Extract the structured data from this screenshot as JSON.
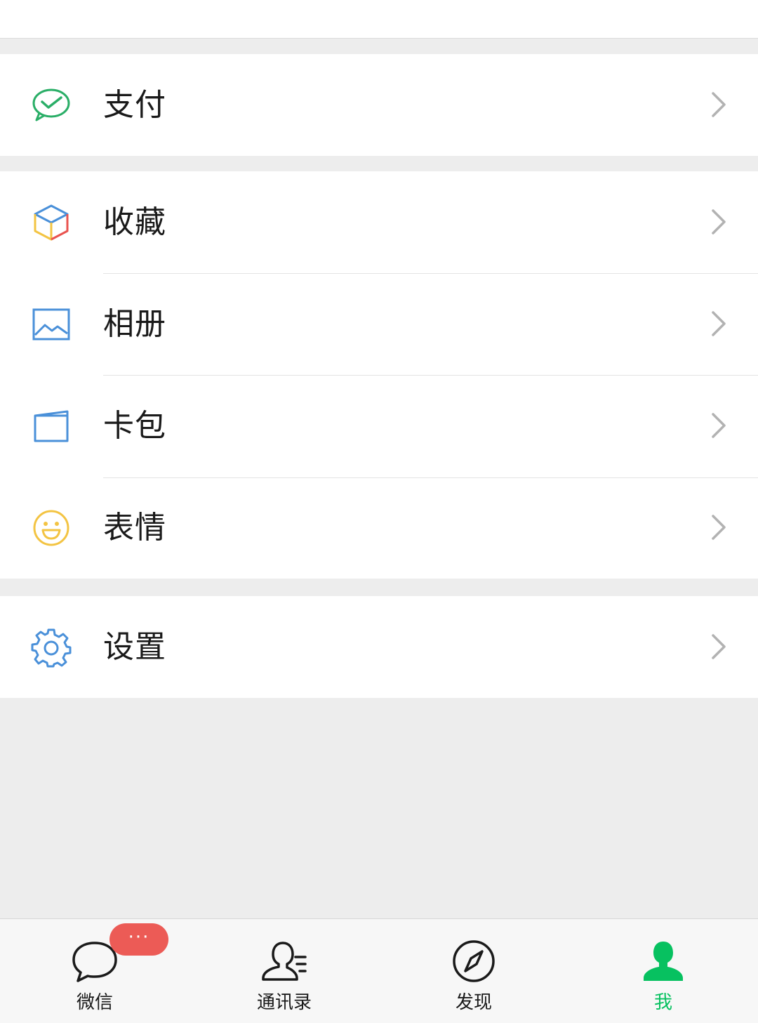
{
  "menu": {
    "group1": [
      {
        "label": "支付",
        "icon": "wechat-pay-icon"
      }
    ],
    "group2": [
      {
        "label": "收藏",
        "icon": "favorites-cube-icon"
      },
      {
        "label": "相册",
        "icon": "album-picture-icon"
      },
      {
        "label": "卡包",
        "icon": "card-wallet-icon"
      },
      {
        "label": "表情",
        "icon": "smiley-face-icon"
      }
    ],
    "group3": [
      {
        "label": "设置",
        "icon": "gear-icon"
      }
    ]
  },
  "tabbar": {
    "tabs": [
      {
        "label": "微信",
        "icon": "chat-bubble-icon"
      },
      {
        "label": "通讯录",
        "icon": "contacts-icon"
      },
      {
        "label": "发现",
        "icon": "compass-icon"
      },
      {
        "label": "我",
        "icon": "person-icon"
      }
    ],
    "badge": "···",
    "active_index": 3
  },
  "colors": {
    "accent_green": "#07c160",
    "badge_red": "#ec5b56",
    "background": "#ededed"
  }
}
